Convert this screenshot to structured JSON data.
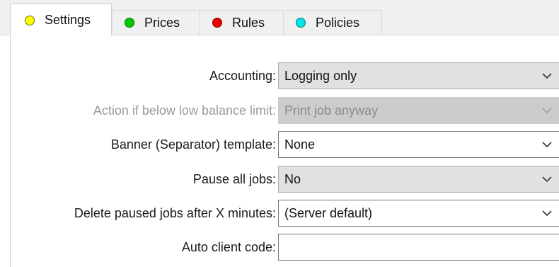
{
  "tabs": [
    {
      "label": "Settings",
      "color": "#ffff00",
      "border": "#7a7a00",
      "active": true
    },
    {
      "label": "Prices",
      "color": "#00cc00",
      "border": "#007a00",
      "active": false
    },
    {
      "label": "Rules",
      "color": "#ee0000",
      "border": "#8a0000",
      "active": false
    },
    {
      "label": "Policies",
      "color": "#00e5e5",
      "border": "#007a7a",
      "active": false
    }
  ],
  "form": {
    "accounting": {
      "label": "Accounting:",
      "value": "Logging only"
    },
    "low_balance_action": {
      "label": "Action if below low balance limit:",
      "value": "Print job anyway",
      "disabled": true
    },
    "banner_template": {
      "label": "Banner (Separator) template:",
      "value": "None"
    },
    "pause_all_jobs": {
      "label": "Pause all jobs:",
      "value": "No"
    },
    "delete_paused_jobs": {
      "label": "Delete paused jobs after X minutes:",
      "value": "(Server default)"
    },
    "auto_client_code": {
      "label": "Auto client code:",
      "value": ""
    }
  },
  "icons": {
    "dropdown": "chevron-down-icon"
  }
}
